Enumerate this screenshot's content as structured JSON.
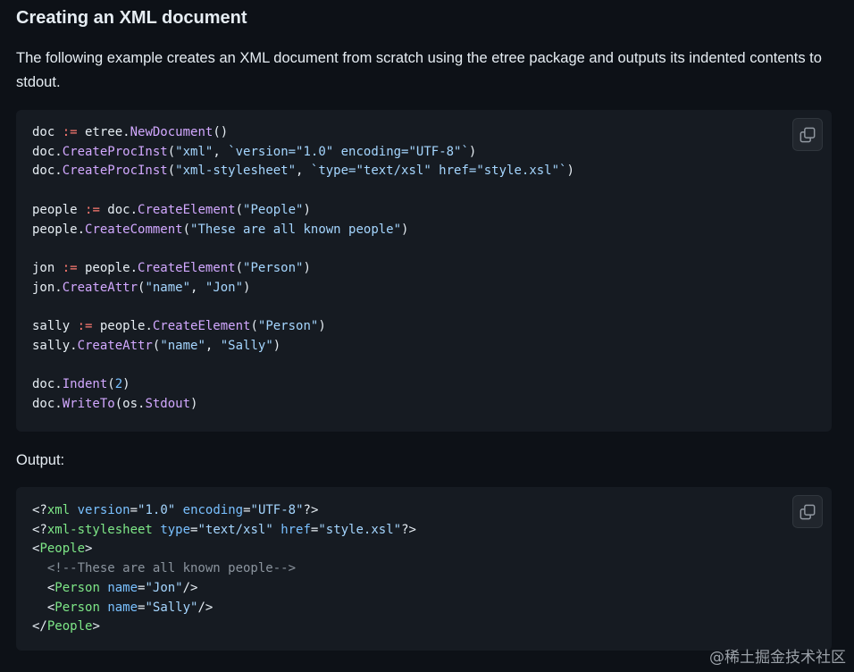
{
  "heading": "Creating an XML document",
  "description": "The following example creates an XML document from scratch using the etree package and outputs its indented contents to stdout.",
  "output_label": "Output:",
  "watermark": "@稀土掘金技术社区",
  "code_blocks": [
    {
      "language": "go",
      "lines": [
        [
          [
            "doc ",
            "pun"
          ],
          [
            ":=",
            "op"
          ],
          [
            " etree.",
            "pun"
          ],
          [
            "NewDocument",
            "fn"
          ],
          [
            "()",
            "pun"
          ]
        ],
        [
          [
            "doc.",
            "pun"
          ],
          [
            "CreateProcInst",
            "fn"
          ],
          [
            "(",
            "pun"
          ],
          [
            "\"xml\"",
            "str"
          ],
          [
            ", ",
            "pun"
          ],
          [
            "`version=\"1.0\" encoding=\"UTF-8\"`",
            "str"
          ],
          [
            ")",
            "pun"
          ]
        ],
        [
          [
            "doc.",
            "pun"
          ],
          [
            "CreateProcInst",
            "fn"
          ],
          [
            "(",
            "pun"
          ],
          [
            "\"xml-stylesheet\"",
            "str"
          ],
          [
            ", ",
            "pun"
          ],
          [
            "`type=\"text/xsl\" href=\"style.xsl\"`",
            "str"
          ],
          [
            ")",
            "pun"
          ]
        ],
        [],
        [
          [
            "people ",
            "pun"
          ],
          [
            ":=",
            "op"
          ],
          [
            " doc.",
            "pun"
          ],
          [
            "CreateElement",
            "fn"
          ],
          [
            "(",
            "pun"
          ],
          [
            "\"People\"",
            "str"
          ],
          [
            ")",
            "pun"
          ]
        ],
        [
          [
            "people.",
            "pun"
          ],
          [
            "CreateComment",
            "fn"
          ],
          [
            "(",
            "pun"
          ],
          [
            "\"These are all known people\"",
            "str"
          ],
          [
            ")",
            "pun"
          ]
        ],
        [],
        [
          [
            "jon ",
            "pun"
          ],
          [
            ":=",
            "op"
          ],
          [
            " people.",
            "pun"
          ],
          [
            "CreateElement",
            "fn"
          ],
          [
            "(",
            "pun"
          ],
          [
            "\"Person\"",
            "str"
          ],
          [
            ")",
            "pun"
          ]
        ],
        [
          [
            "jon.",
            "pun"
          ],
          [
            "CreateAttr",
            "fn"
          ],
          [
            "(",
            "pun"
          ],
          [
            "\"name\"",
            "str"
          ],
          [
            ", ",
            "pun"
          ],
          [
            "\"Jon\"",
            "str"
          ],
          [
            ")",
            "pun"
          ]
        ],
        [],
        [
          [
            "sally ",
            "pun"
          ],
          [
            ":=",
            "op"
          ],
          [
            " people.",
            "pun"
          ],
          [
            "CreateElement",
            "fn"
          ],
          [
            "(",
            "pun"
          ],
          [
            "\"Person\"",
            "str"
          ],
          [
            ")",
            "pun"
          ]
        ],
        [
          [
            "sally.",
            "pun"
          ],
          [
            "CreateAttr",
            "fn"
          ],
          [
            "(",
            "pun"
          ],
          [
            "\"name\"",
            "str"
          ],
          [
            ", ",
            "pun"
          ],
          [
            "\"Sally\"",
            "str"
          ],
          [
            ")",
            "pun"
          ]
        ],
        [],
        [
          [
            "doc.",
            "pun"
          ],
          [
            "Indent",
            "fn"
          ],
          [
            "(",
            "pun"
          ],
          [
            "2",
            "num"
          ],
          [
            ")",
            "pun"
          ]
        ],
        [
          [
            "doc.",
            "pun"
          ],
          [
            "WriteTo",
            "fn"
          ],
          [
            "(os.",
            "pun"
          ],
          [
            "Stdout",
            "fn"
          ],
          [
            ")",
            "pun"
          ]
        ]
      ]
    },
    {
      "language": "xml",
      "lines": [
        [
          [
            "<?",
            "pun"
          ],
          [
            "xml",
            "tag"
          ],
          [
            " ",
            "pun"
          ],
          [
            "version",
            "attr"
          ],
          [
            "=",
            "pun"
          ],
          [
            "\"1.0\"",
            "str"
          ],
          [
            " ",
            "pun"
          ],
          [
            "encoding",
            "attr"
          ],
          [
            "=",
            "pun"
          ],
          [
            "\"UTF-8\"",
            "str"
          ],
          [
            "?>",
            "pun"
          ]
        ],
        [
          [
            "<?",
            "pun"
          ],
          [
            "xml-stylesheet",
            "tag"
          ],
          [
            " ",
            "pun"
          ],
          [
            "type",
            "attr"
          ],
          [
            "=",
            "pun"
          ],
          [
            "\"text/xsl\"",
            "str"
          ],
          [
            " ",
            "pun"
          ],
          [
            "href",
            "attr"
          ],
          [
            "=",
            "pun"
          ],
          [
            "\"style.xsl\"",
            "str"
          ],
          [
            "?>",
            "pun"
          ]
        ],
        [
          [
            "<",
            "pun"
          ],
          [
            "People",
            "tag"
          ],
          [
            ">",
            "pun"
          ]
        ],
        [
          [
            "  ",
            "pun"
          ],
          [
            "<!--These are all known people-->",
            "cmt"
          ]
        ],
        [
          [
            "  <",
            "pun"
          ],
          [
            "Person",
            "tag"
          ],
          [
            " ",
            "pun"
          ],
          [
            "name",
            "attr"
          ],
          [
            "=",
            "pun"
          ],
          [
            "\"Jon\"",
            "str"
          ],
          [
            "/>",
            "pun"
          ]
        ],
        [
          [
            "  <",
            "pun"
          ],
          [
            "Person",
            "tag"
          ],
          [
            " ",
            "pun"
          ],
          [
            "name",
            "attr"
          ],
          [
            "=",
            "pun"
          ],
          [
            "\"Sally\"",
            "str"
          ],
          [
            "/>",
            "pun"
          ]
        ],
        [
          [
            "</",
            "pun"
          ],
          [
            "People",
            "tag"
          ],
          [
            ">",
            "pun"
          ]
        ]
      ]
    }
  ],
  "icons": {
    "copy": "copy-icon"
  },
  "colors": {
    "background": "#0d1117",
    "code_background": "#161b22",
    "function": "#d2a8ff",
    "string": "#a5d6ff",
    "operator": "#ff7b72",
    "tag": "#7ee787",
    "comment": "#8b949e"
  }
}
